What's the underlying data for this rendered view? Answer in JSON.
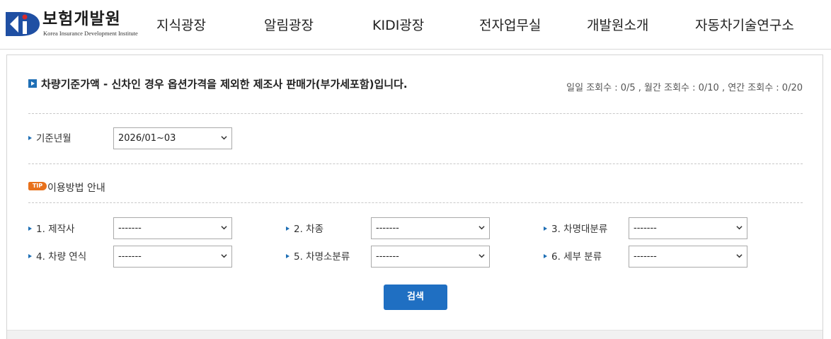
{
  "header": {
    "logo_kr": "보험개발원",
    "logo_en": "Korea Insurance Development Institute",
    "nav": [
      "지식광장",
      "알림광장",
      "KIDI광장",
      "전자업무실",
      "개발원소개",
      "자동차기술연구소"
    ]
  },
  "page": {
    "title": "차량기준가액 - 신차인 경우 옵션가격을 제외한 제조사 판매가(부가세포함)입니다.",
    "counts": "일일 조회수 : 0/5 , 월간 조회수 : 0/10 , 연간 조회수 : 0/20"
  },
  "base_month": {
    "label": "기준년월",
    "value": "2026/01~03"
  },
  "tip": {
    "badge": "TIP",
    "text": "이용방법 안내"
  },
  "filters": [
    {
      "label": "1. 제작사",
      "value": "-------"
    },
    {
      "label": "2. 차종",
      "value": "-------"
    },
    {
      "label": "3. 차명대분류",
      "value": "-------"
    },
    {
      "label": "4. 차량 연식",
      "value": "-------"
    },
    {
      "label": "5. 차명소분류",
      "value": "-------"
    },
    {
      "label": "6. 세부 분류",
      "value": "-------"
    }
  ],
  "search_button": "검색",
  "colors": {
    "accent": "#1f6fc2",
    "tip": "#e8711c",
    "logo_blue": "#1f4fa3",
    "logo_red": "#d62b2b"
  }
}
